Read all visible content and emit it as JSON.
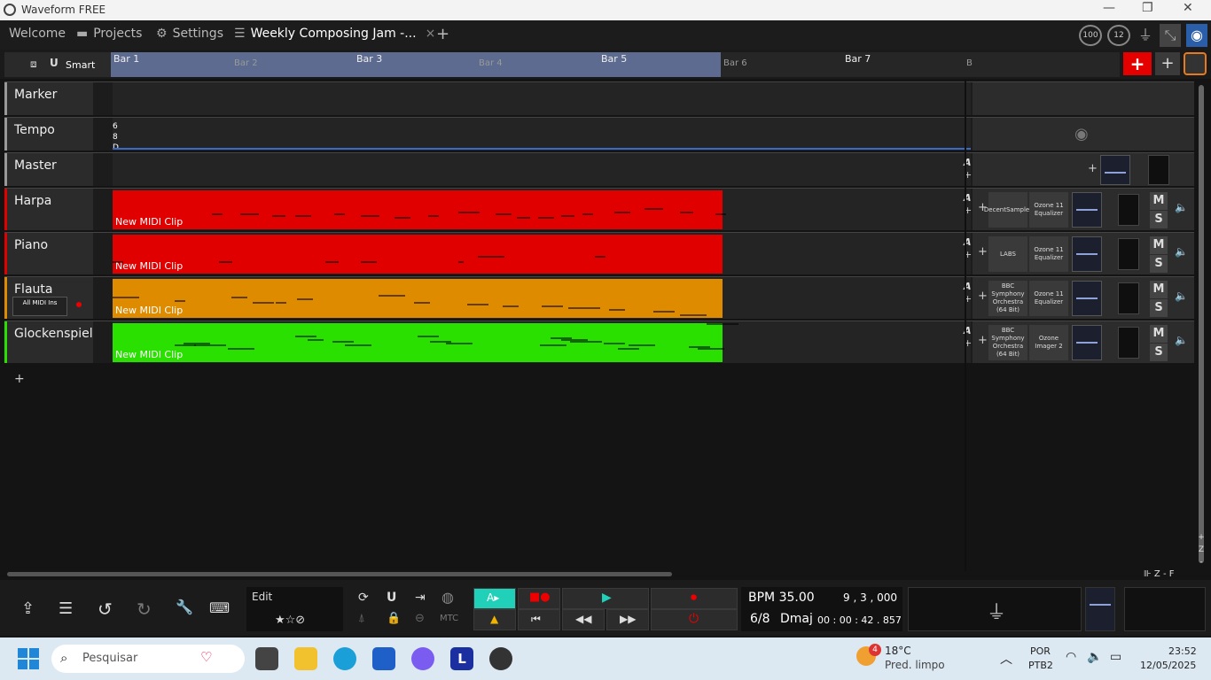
{
  "window": {
    "title": "Waveform FREE",
    "minimize": "—",
    "maximize": "❐",
    "close": "✕"
  },
  "tabs": [
    {
      "label": "Welcome"
    },
    {
      "label": "Projects",
      "icon": "folder-icon"
    },
    {
      "label": "Settings",
      "icon": "gear-icon"
    },
    {
      "label": "Weekly Composing Jam -...",
      "icon": "edit-icon",
      "close": "×"
    }
  ],
  "tab_add": "+",
  "topright": {
    "badge1": "100",
    "badge2": "12"
  },
  "ruler": {
    "mode": "Smart",
    "bars": [
      {
        "label": "Bar 1"
      },
      {
        "label": "Bar 2"
      },
      {
        "label": "Bar 3"
      },
      {
        "label": "Bar 4"
      },
      {
        "label": "Bar 5"
      },
      {
        "label": "Bar 6"
      },
      {
        "label": "Bar 7"
      },
      {
        "label": "B"
      }
    ],
    "add_red": "+",
    "add_grey": "+"
  },
  "tracks": [
    {
      "name": "Marker"
    },
    {
      "name": "Tempo",
      "ts": [
        "6",
        "8",
        "D"
      ]
    },
    {
      "name": "Master",
      "auto": "A"
    },
    {
      "name": "Harpa",
      "color": "#e00000",
      "clip": "New MIDI Clip",
      "plugins": [
        "DecentSampler",
        "Ozone 11 Equalizer"
      ]
    },
    {
      "name": "Piano",
      "color": "#e00000",
      "clip": "New MIDI Clip",
      "plugins": [
        "LABS",
        "Ozone 11 Equalizer"
      ]
    },
    {
      "name": "Flauta",
      "color": "#de8b00",
      "clip": "New MIDI Clip",
      "input": "All MIDI Ins",
      "plugins": [
        "BBC Symphony Orchestra (64 Bit)",
        "Ozone 11 Equalizer"
      ]
    },
    {
      "name": "Glockenspiel",
      "color": "#2ae000",
      "clip": "New MIDI Clip",
      "plugins": [
        "BBC Symphony Orchestra (64 Bit)",
        "Ozone Imager 2"
      ]
    }
  ],
  "mute": "M",
  "solo": "S",
  "add_track": "+",
  "zoom": {
    "plus": "+",
    "z": "Z",
    "minus": "-",
    "f": "F",
    "hz": "Z"
  },
  "transport": {
    "edit_label": "Edit",
    "mtc": "MTC",
    "bpm": "BPM 35.00",
    "position": "9 , 3 , 000",
    "timesig": "6/8",
    "key": "Dmaj",
    "time": "00 : 00 : 42 . 857"
  },
  "taskbar": {
    "search_placeholder": "Pesquisar",
    "weather_temp": "18°C",
    "weather_desc": "Pred. limpo",
    "weather_badge": "4",
    "lang1": "POR",
    "lang2": "PTB2",
    "clock_time": "23:52",
    "clock_date": "12/05/2025"
  }
}
